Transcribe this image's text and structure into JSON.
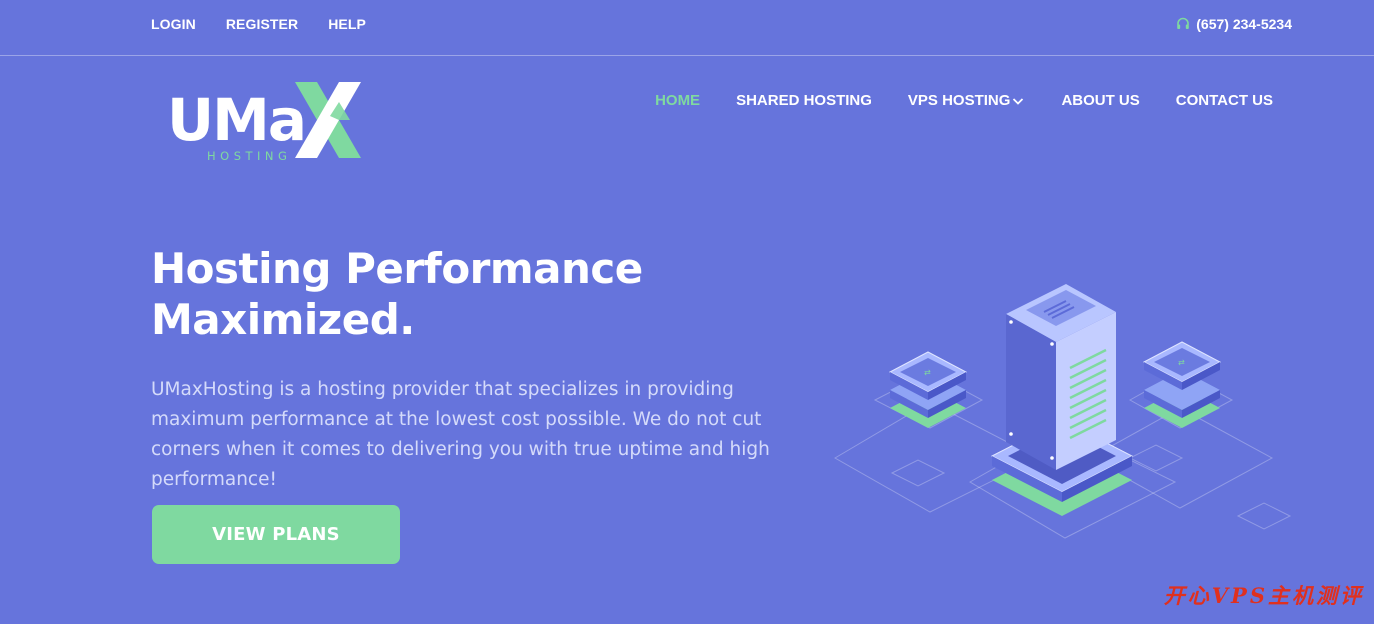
{
  "topbar": {
    "links": [
      {
        "label": "LOGIN"
      },
      {
        "label": "REGISTER"
      },
      {
        "label": "HELP"
      }
    ],
    "phone": "(657) 234-5234",
    "phone_icon": "headset-icon"
  },
  "brand": {
    "logo_text": "UMaX",
    "logo_sub": "HOSTING"
  },
  "nav": {
    "items": [
      {
        "label": "HOME",
        "active": true
      },
      {
        "label": "SHARED HOSTING"
      },
      {
        "label": "VPS HOSTING",
        "dropdown": true
      },
      {
        "label": "ABOUT US"
      },
      {
        "label": "CONTACT US"
      }
    ]
  },
  "hero": {
    "title_line1": "Hosting Performance",
    "title_line2": "Maximized.",
    "description": "UMaxHosting is a hosting provider that specializes in providing maximum performance at the lowest cost possible. We do not cut corners when it comes to delivering you with true uptime and high performance!",
    "cta": "VIEW PLANS"
  },
  "watermark": "开心VPS主机测评",
  "colors": {
    "background": "#6674dc",
    "accent": "#7fd9a0",
    "watermark": "#e0301e"
  }
}
